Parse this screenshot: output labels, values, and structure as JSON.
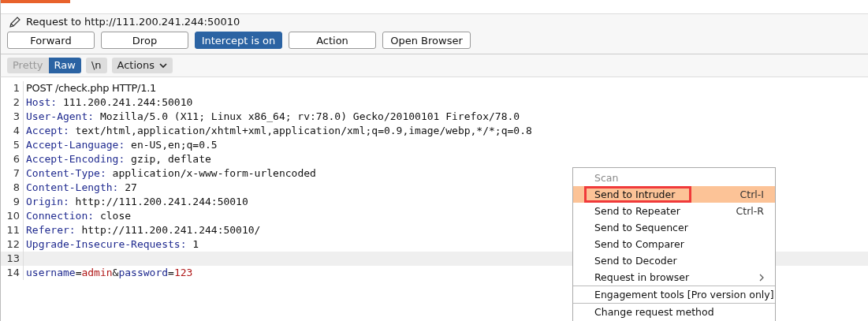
{
  "request_title": "Request to http://111.200.241.244:50010",
  "buttons": [
    {
      "label": "Forward",
      "on": false
    },
    {
      "label": "Drop",
      "on": false
    },
    {
      "label": "Intercept is on",
      "on": true
    },
    {
      "label": "Action",
      "on": false
    },
    {
      "label": "Open Browser",
      "on": false
    }
  ],
  "view_tabs": [
    {
      "label": "Pretty",
      "selected": false
    },
    {
      "label": "Raw",
      "selected": true
    }
  ],
  "newline_toggle": {
    "label": "\\n"
  },
  "actions_menu": {
    "label": "Actions"
  },
  "lines": [
    {
      "number": "1",
      "highlighted": false,
      "tokens": [
        {
          "kind": "plain",
          "text": "POST /check.php HTTP/1.1"
        }
      ]
    },
    {
      "number": "2",
      "highlighted": false,
      "tokens": [
        {
          "kind": "key",
          "text": "Host:"
        },
        {
          "kind": "value",
          "text": " 111.200.241.244:50010"
        }
      ]
    },
    {
      "number": "3",
      "highlighted": false,
      "tokens": [
        {
          "kind": "key",
          "text": "User-Agent:"
        },
        {
          "kind": "value",
          "text": " Mozilla/5.0 (X11; Linux x86_64; rv:78.0) Gecko/20100101 Firefox/78.0"
        }
      ]
    },
    {
      "number": "4",
      "highlighted": false,
      "tokens": [
        {
          "kind": "key",
          "text": "Accept:"
        },
        {
          "kind": "value",
          "text": " text/html,application/xhtml+xml,application/xml;q=0.9,image/webp,*/*;q=0.8"
        }
      ]
    },
    {
      "number": "5",
      "highlighted": false,
      "tokens": [
        {
          "kind": "key",
          "text": "Accept-Language:"
        },
        {
          "kind": "value",
          "text": " en-US,en;q=0.5"
        }
      ]
    },
    {
      "number": "6",
      "highlighted": false,
      "tokens": [
        {
          "kind": "key",
          "text": "Accept-Encoding:"
        },
        {
          "kind": "value",
          "text": " gzip, deflate"
        }
      ]
    },
    {
      "number": "7",
      "highlighted": false,
      "tokens": [
        {
          "kind": "key",
          "text": "Content-Type:"
        },
        {
          "kind": "value",
          "text": " application/x-www-form-urlencoded"
        }
      ]
    },
    {
      "number": "8",
      "highlighted": false,
      "tokens": [
        {
          "kind": "key",
          "text": "Content-Length:"
        },
        {
          "kind": "value",
          "text": " 27"
        }
      ]
    },
    {
      "number": "9",
      "highlighted": false,
      "tokens": [
        {
          "kind": "key",
          "text": "Origin:"
        },
        {
          "kind": "value",
          "text": " http://111.200.241.244:50010"
        }
      ]
    },
    {
      "number": "10",
      "highlighted": false,
      "tokens": [
        {
          "kind": "key",
          "text": "Connection:"
        },
        {
          "kind": "value",
          "text": " close"
        }
      ]
    },
    {
      "number": "11",
      "highlighted": false,
      "tokens": [
        {
          "kind": "key",
          "text": "Referer:"
        },
        {
          "kind": "value",
          "text": " http://111.200.241.244:50010/"
        }
      ]
    },
    {
      "number": "12",
      "highlighted": false,
      "tokens": [
        {
          "kind": "key",
          "text": "Upgrade-Insecure-Requests:"
        },
        {
          "kind": "value",
          "text": " 1"
        }
      ]
    },
    {
      "number": "13",
      "highlighted": true
    },
    {
      "number": "14",
      "highlighted": false,
      "tokens": [
        {
          "kind": "param",
          "text": "username"
        },
        {
          "kind": "value",
          "text": "="
        },
        {
          "kind": "param_value",
          "text": "admin"
        },
        {
          "kind": "value",
          "text": "&"
        },
        {
          "kind": "param",
          "text": "password"
        },
        {
          "kind": "value",
          "text": "="
        },
        {
          "kind": "param_value",
          "text": "123"
        }
      ]
    }
  ],
  "context_menu": {
    "items": [
      {
        "label": "Scan",
        "disabled": true,
        "selected": false
      },
      {
        "label": "Send to Intruder",
        "shortcut": "Ctrl-I",
        "disabled": false,
        "selected": true,
        "annotated": true
      },
      {
        "label": "Send to Repeater",
        "shortcut": "Ctrl-R",
        "disabled": false,
        "selected": false
      },
      {
        "label": "Send to Sequencer",
        "disabled": false,
        "selected": false
      },
      {
        "label": "Send to Comparer",
        "disabled": false,
        "selected": false
      },
      {
        "label": "Send to Decoder",
        "disabled": false,
        "selected": false
      },
      {
        "label": "Request in browser",
        "disabled": false,
        "selected": false,
        "submenu": true
      },
      {
        "label": "Engagement tools [Pro version only]",
        "disabled": false,
        "selected": false,
        "separator_before": true
      },
      {
        "label": "Change request method",
        "disabled": false,
        "selected": false,
        "separator_before": true
      }
    ]
  }
}
